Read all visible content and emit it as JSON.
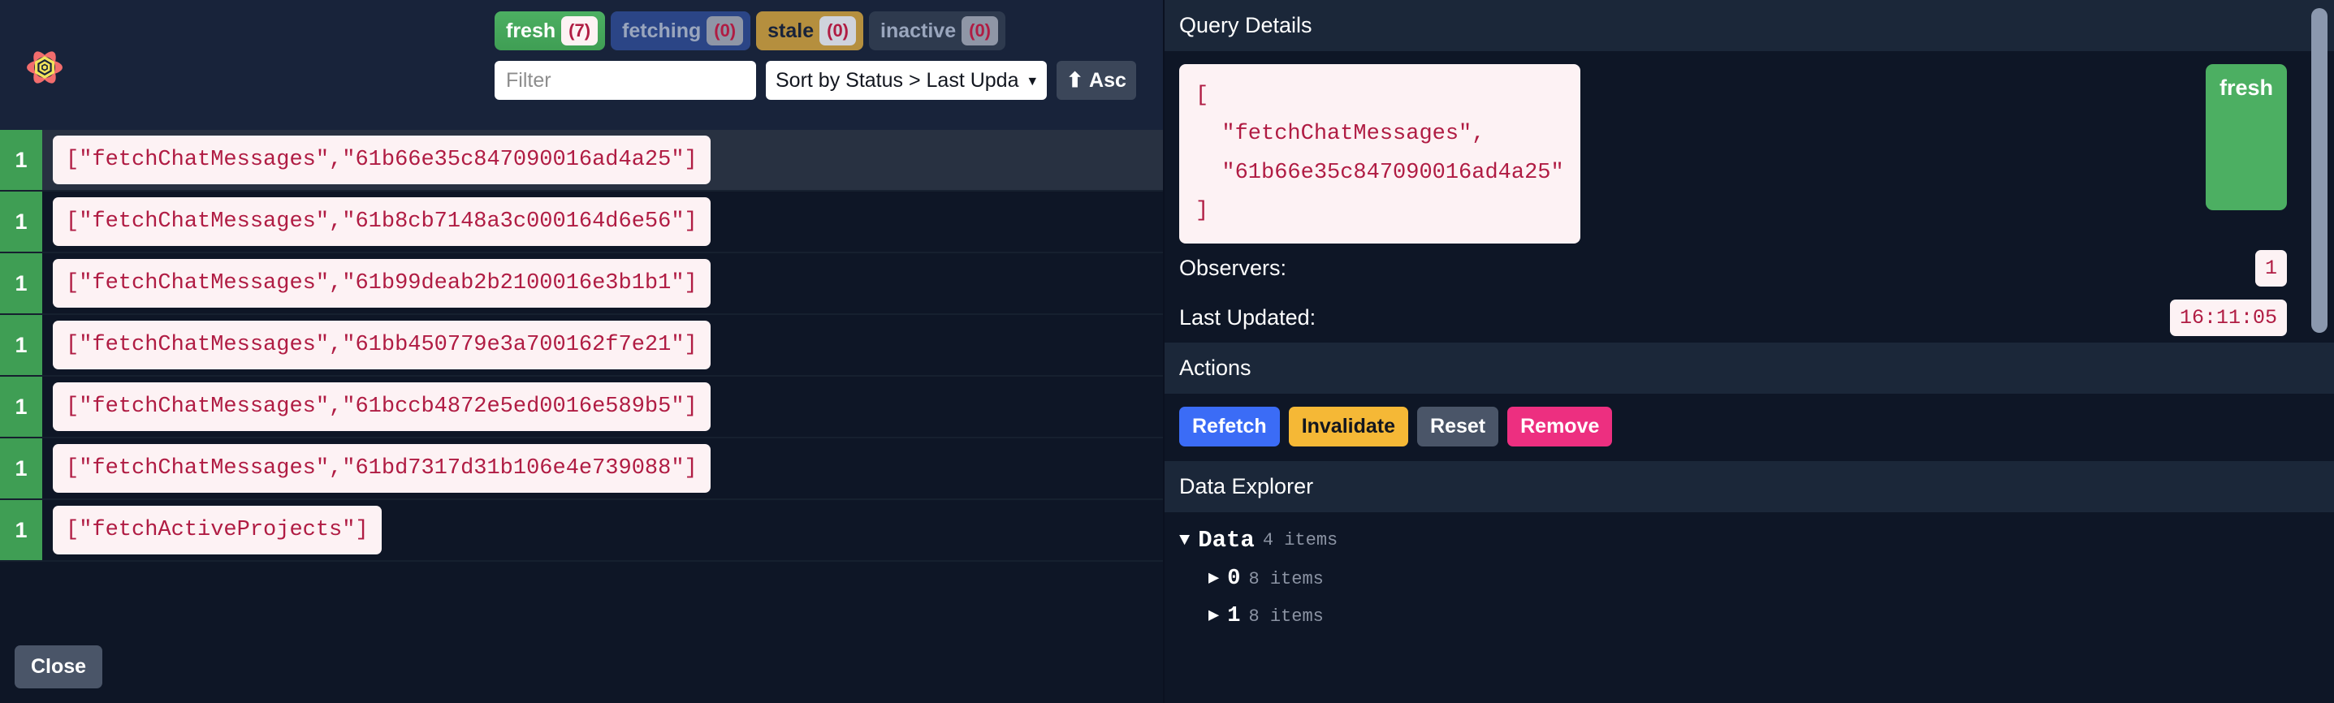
{
  "app": {
    "logo_icon": "react-query-atom-logo",
    "close_label": "Close"
  },
  "status_filters": [
    {
      "label": "fresh",
      "count": "(7)",
      "state": "active",
      "key": "fresh"
    },
    {
      "label": "fetching",
      "count": "(0)",
      "state": "inactive",
      "key": "fetching"
    },
    {
      "label": "stale",
      "count": "(0)",
      "state": "inactive",
      "key": "stale"
    },
    {
      "label": "inactive",
      "count": "(0)",
      "state": "inactive",
      "key": "inactive"
    }
  ],
  "controls": {
    "filter_placeholder": "Filter",
    "filter_value": "",
    "sort_value": "Sort by Status > Last Upda",
    "sort_caret_icon": "chevron-down-icon",
    "sort_direction_label": "Asc",
    "sort_direction_icon": "arrow-up-icon"
  },
  "queries": [
    {
      "observers": "1",
      "key": "[\"fetchChatMessages\",\"61b66e35c847090016ad4a25\"]",
      "status": "fresh",
      "selected": true
    },
    {
      "observers": "1",
      "key": "[\"fetchChatMessages\",\"61b8cb7148a3c000164d6e56\"]",
      "status": "fresh",
      "selected": false
    },
    {
      "observers": "1",
      "key": "[\"fetchChatMessages\",\"61b99deab2b2100016e3b1b1\"]",
      "status": "fresh",
      "selected": false
    },
    {
      "observers": "1",
      "key": "[\"fetchChatMessages\",\"61bb450779e3a700162f7e21\"]",
      "status": "fresh",
      "selected": false
    },
    {
      "observers": "1",
      "key": "[\"fetchChatMessages\",\"61bccb4872e5ed0016e589b5\"]",
      "status": "fresh",
      "selected": false
    },
    {
      "observers": "1",
      "key": "[\"fetchChatMessages\",\"61bd7317d31b106e4e739088\"]",
      "status": "fresh",
      "selected": false
    },
    {
      "observers": "1",
      "key": "[\"fetchActiveProjects\"]",
      "status": "fresh",
      "selected": false
    }
  ],
  "details": {
    "title": "Query Details",
    "query_key_json": "[\n  \"fetchChatMessages\",\n  \"61b66e35c847090016ad4a25\"\n]",
    "status_badge": "fresh",
    "observers_label": "Observers:",
    "observers_value": "1",
    "last_updated_label": "Last Updated:",
    "last_updated_value": "16:11:05"
  },
  "actions": {
    "title": "Actions",
    "buttons": [
      {
        "label": "Refetch",
        "variant": "refetch"
      },
      {
        "label": "Invalidate",
        "variant": "invalidate"
      },
      {
        "label": "Reset",
        "variant": "reset"
      },
      {
        "label": "Remove",
        "variant": "remove"
      }
    ]
  },
  "data_explorer": {
    "title": "Data Explorer",
    "nodes": [
      {
        "arrow": "▼",
        "label": "Data",
        "meta": "4 items",
        "level": 0
      },
      {
        "arrow": "▶",
        "label": "0",
        "meta": "8 items",
        "level": 1
      },
      {
        "arrow": "▶",
        "label": "1",
        "meta": "8 items",
        "level": 1
      }
    ]
  },
  "colors": {
    "background": "#16202f",
    "panel": "#0e1626",
    "section_header": "#1b2739",
    "fresh": "#4caf62",
    "fetching": "#2b4586",
    "stale": "#b58f3e",
    "inactive": "#2e3a4e",
    "key_text": "#b01c43",
    "key_bg": "#fdf2f4",
    "refetch": "#3b6cf6",
    "invalidate": "#f5b836",
    "reset": "#4a5568",
    "remove": "#ed2f80"
  }
}
